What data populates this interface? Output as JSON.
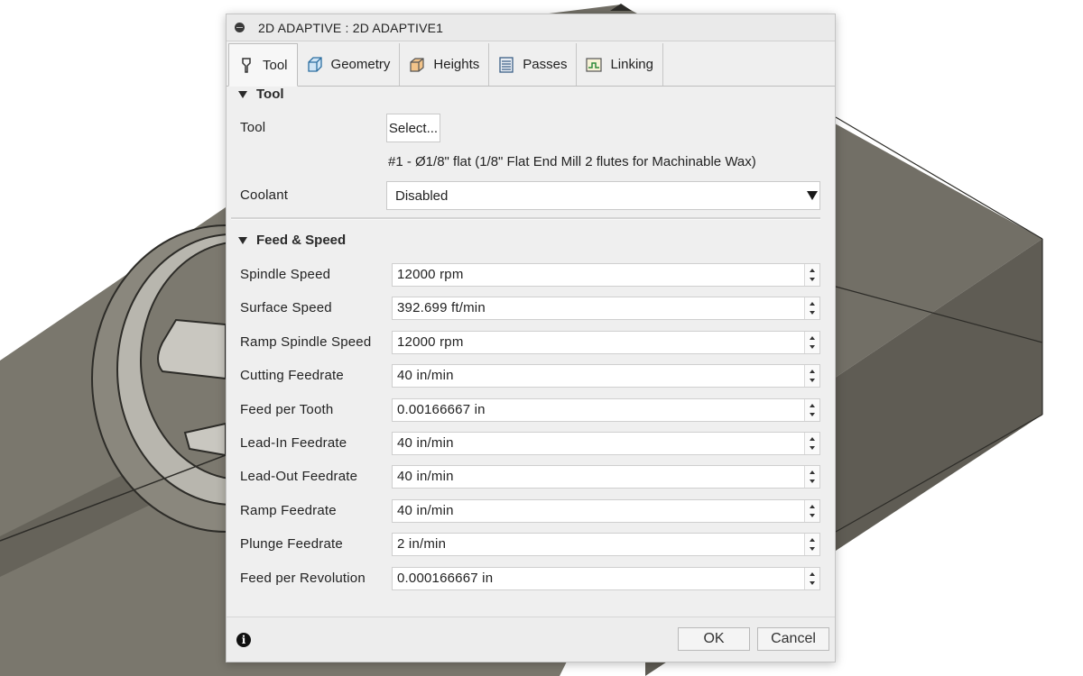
{
  "dialog": {
    "title": "2D ADAPTIVE : 2D ADAPTIVE1",
    "tabs": [
      {
        "label": "Tool",
        "icon": "tool-icon",
        "active": true
      },
      {
        "label": "Geometry",
        "icon": "geometry-icon",
        "active": false
      },
      {
        "label": "Heights",
        "icon": "heights-icon",
        "active": false
      },
      {
        "label": "Passes",
        "icon": "passes-icon",
        "active": false
      },
      {
        "label": "Linking",
        "icon": "linking-icon",
        "active": false
      }
    ],
    "tool_section": {
      "header": "Tool",
      "tool_label": "Tool",
      "select_button": "Select...",
      "tool_description": "#1 - Ø1/8\" flat (1/8\" Flat End Mill 2 flutes for Machinable Wax)",
      "coolant_label": "Coolant",
      "coolant_value": "Disabled"
    },
    "feed_section": {
      "header": "Feed & Speed",
      "fields": [
        {
          "label": "Spindle Speed",
          "value": "12000 rpm"
        },
        {
          "label": "Surface Speed",
          "value": "392.699 ft/min"
        },
        {
          "label": "Ramp Spindle Speed",
          "value": "12000 rpm"
        },
        {
          "label": "Cutting Feedrate",
          "value": "40 in/min"
        },
        {
          "label": "Feed per Tooth",
          "value": "0.00166667 in"
        },
        {
          "label": "Lead-In Feedrate",
          "value": "40 in/min"
        },
        {
          "label": "Lead-Out Feedrate",
          "value": "40 in/min"
        },
        {
          "label": "Ramp Feedrate",
          "value": "40 in/min"
        },
        {
          "label": "Plunge Feedrate",
          "value": "2 in/min"
        },
        {
          "label": "Feed per Revolution",
          "value": "0.000166667 in"
        }
      ]
    },
    "footer": {
      "info_icon": "info-icon",
      "ok_label": "OK",
      "cancel_label": "Cancel"
    }
  },
  "colors": {
    "model_face": "#7a776d",
    "model_top": "#6c695f",
    "model_side": "#5e5b52",
    "dialog_bg": "#efefef",
    "field_bg": "#ffffff"
  }
}
